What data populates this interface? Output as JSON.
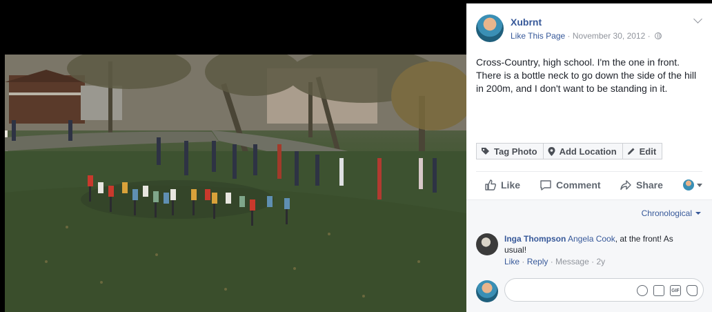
{
  "post": {
    "author": "Xubrnt",
    "like_page": "Like This Page",
    "separator": "·",
    "date": "November 30, 2012",
    "caption": "Cross-Country, high school. I'm the one in front. There is a bottle neck to go down the side of the hill in 200m, and I don't want to be standing in it."
  },
  "photo_actions": {
    "tag_photo": "Tag Photo",
    "add_location": "Add Location",
    "edit": "Edit"
  },
  "reactions": {
    "like": "Like",
    "comment": "Comment",
    "share": "Share"
  },
  "comments": {
    "sort_label": "Chronological",
    "items": [
      {
        "author": "Inga Thompson",
        "tagged": "Angela Cook",
        "text": ", at the front! As usual!",
        "like": "Like",
        "reply": "Reply",
        "message": "Message",
        "age": "2y"
      }
    ]
  },
  "icons": {
    "tag": "tag-icon",
    "location": "location-pin-icon",
    "edit": "pencil-icon",
    "like": "thumbs-up-icon",
    "comment": "speech-bubble-icon",
    "share": "share-arrow-icon",
    "globe": "globe-icon",
    "emoji": "smiley-icon",
    "camera": "camera-icon",
    "gif": "gif-icon",
    "sticker": "sticker-icon"
  },
  "colors": {
    "link": "#365899",
    "text": "#1d2129",
    "muted": "#90949c",
    "panel_bg": "#ffffff",
    "comments_bg": "#f6f7f9"
  }
}
